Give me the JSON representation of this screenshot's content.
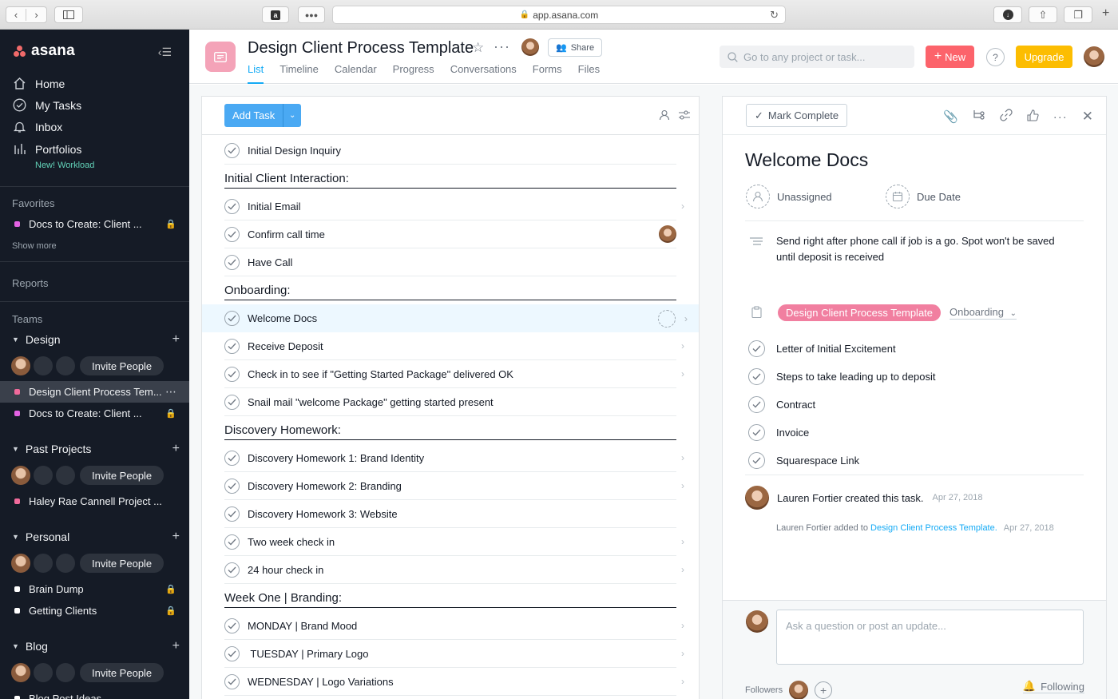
{
  "browser": {
    "url": "app.asana.com"
  },
  "sidebar": {
    "brand": "asana",
    "nav": [
      {
        "label": "Home",
        "icon": "home-icon"
      },
      {
        "label": "My Tasks",
        "icon": "check-circle-icon"
      },
      {
        "label": "Inbox",
        "icon": "bell-icon"
      },
      {
        "label": "Portfolios",
        "icon": "bar-chart-icon"
      }
    ],
    "new_tag": "New! Workload",
    "favorites": {
      "heading": "Favorites",
      "items": [
        {
          "label": "Docs to Create: Client ...",
          "color": "#e362e3"
        }
      ],
      "show_more": "Show more"
    },
    "reports": "Reports",
    "teams_heading": "Teams",
    "invite_label": "Invite People",
    "teams": [
      {
        "name": "Design",
        "projects": [
          {
            "label": "Design Client Process Tem...",
            "color": "#f06a9b"
          },
          {
            "label": "Docs to Create: Client ...",
            "color": "#e362e3"
          }
        ]
      },
      {
        "name": "Past Projects",
        "projects": [
          {
            "label": "Haley Rae Cannell Project ...",
            "color": "#f06a9b"
          }
        ]
      },
      {
        "name": "Personal",
        "projects": [
          {
            "label": "Brain Dump",
            "color": "#ffffff"
          },
          {
            "label": "Getting Clients",
            "color": "#ffffff"
          }
        ]
      },
      {
        "name": "Blog",
        "projects": [
          {
            "label": "Blog Post Ideas",
            "color": "#ffffff"
          }
        ]
      }
    ]
  },
  "header": {
    "title": "Design Client Process Template",
    "share_label": "Share",
    "tabs": [
      "List",
      "Timeline",
      "Calendar",
      "Progress",
      "Conversations",
      "Forms",
      "Files"
    ],
    "search_placeholder": "Go to any project or task...",
    "new_label": "New",
    "help_label": "?",
    "upgrade_label": "Upgrade"
  },
  "list": {
    "add_task": "Add Task",
    "items": [
      {
        "type": "task",
        "label": "Initial Design Inquiry"
      },
      {
        "type": "section",
        "label": "Initial Client Interaction:"
      },
      {
        "type": "task",
        "label": "Initial Email"
      },
      {
        "type": "task",
        "label": "Confirm call time"
      },
      {
        "type": "task",
        "label": "Have Call"
      },
      {
        "type": "section",
        "label": "Onboarding:"
      },
      {
        "type": "task",
        "label": "Welcome Docs"
      },
      {
        "type": "task",
        "label": "Receive Deposit"
      },
      {
        "type": "task",
        "label": "Check in to see if \"Getting Started Package\" delivered OK"
      },
      {
        "type": "task",
        "label": "Snail mail \"welcome Package\" getting started present"
      },
      {
        "type": "section",
        "label": "Discovery Homework:"
      },
      {
        "type": "task",
        "label": "Discovery Homework 1: Brand Identity"
      },
      {
        "type": "task",
        "label": "Discovery Homework 2: Branding"
      },
      {
        "type": "task",
        "label": "Discovery Homework 3: Website"
      },
      {
        "type": "task",
        "label": "Two week check in"
      },
      {
        "type": "task",
        "label": "24 hour check in"
      },
      {
        "type": "section",
        "label": "Week One | Branding:"
      },
      {
        "type": "task",
        "label": "MONDAY | Brand Mood"
      },
      {
        "type": "task",
        "label": " TUESDAY | Primary Logo"
      },
      {
        "type": "task",
        "label": "WEDNESDAY | Logo Variations"
      }
    ]
  },
  "detail": {
    "mark_complete": "Mark Complete",
    "title": "Welcome Docs",
    "assignee": "Unassigned",
    "due_date": "Due Date",
    "description": "Send right after phone call if job is a go. Spot won't be saved until deposit is received",
    "project_pill": "Design Client Process Template",
    "section": "Onboarding",
    "subtasks": [
      "Letter of Initial Excitement",
      "Steps to take leading up to deposit",
      "Contract",
      "Invoice",
      "Squarespace Link"
    ],
    "story1": {
      "text": "Lauren Fortier created this task.",
      "time": "Apr 27, 2018"
    },
    "story2": {
      "actor": "Lauren Fortier",
      "verb": " added to ",
      "link": "Design Client Process Template.",
      "time": "Apr 27, 2018"
    },
    "comment_placeholder": "Ask a question or post an update...",
    "followers_label": "Followers",
    "following_label": "Following"
  }
}
